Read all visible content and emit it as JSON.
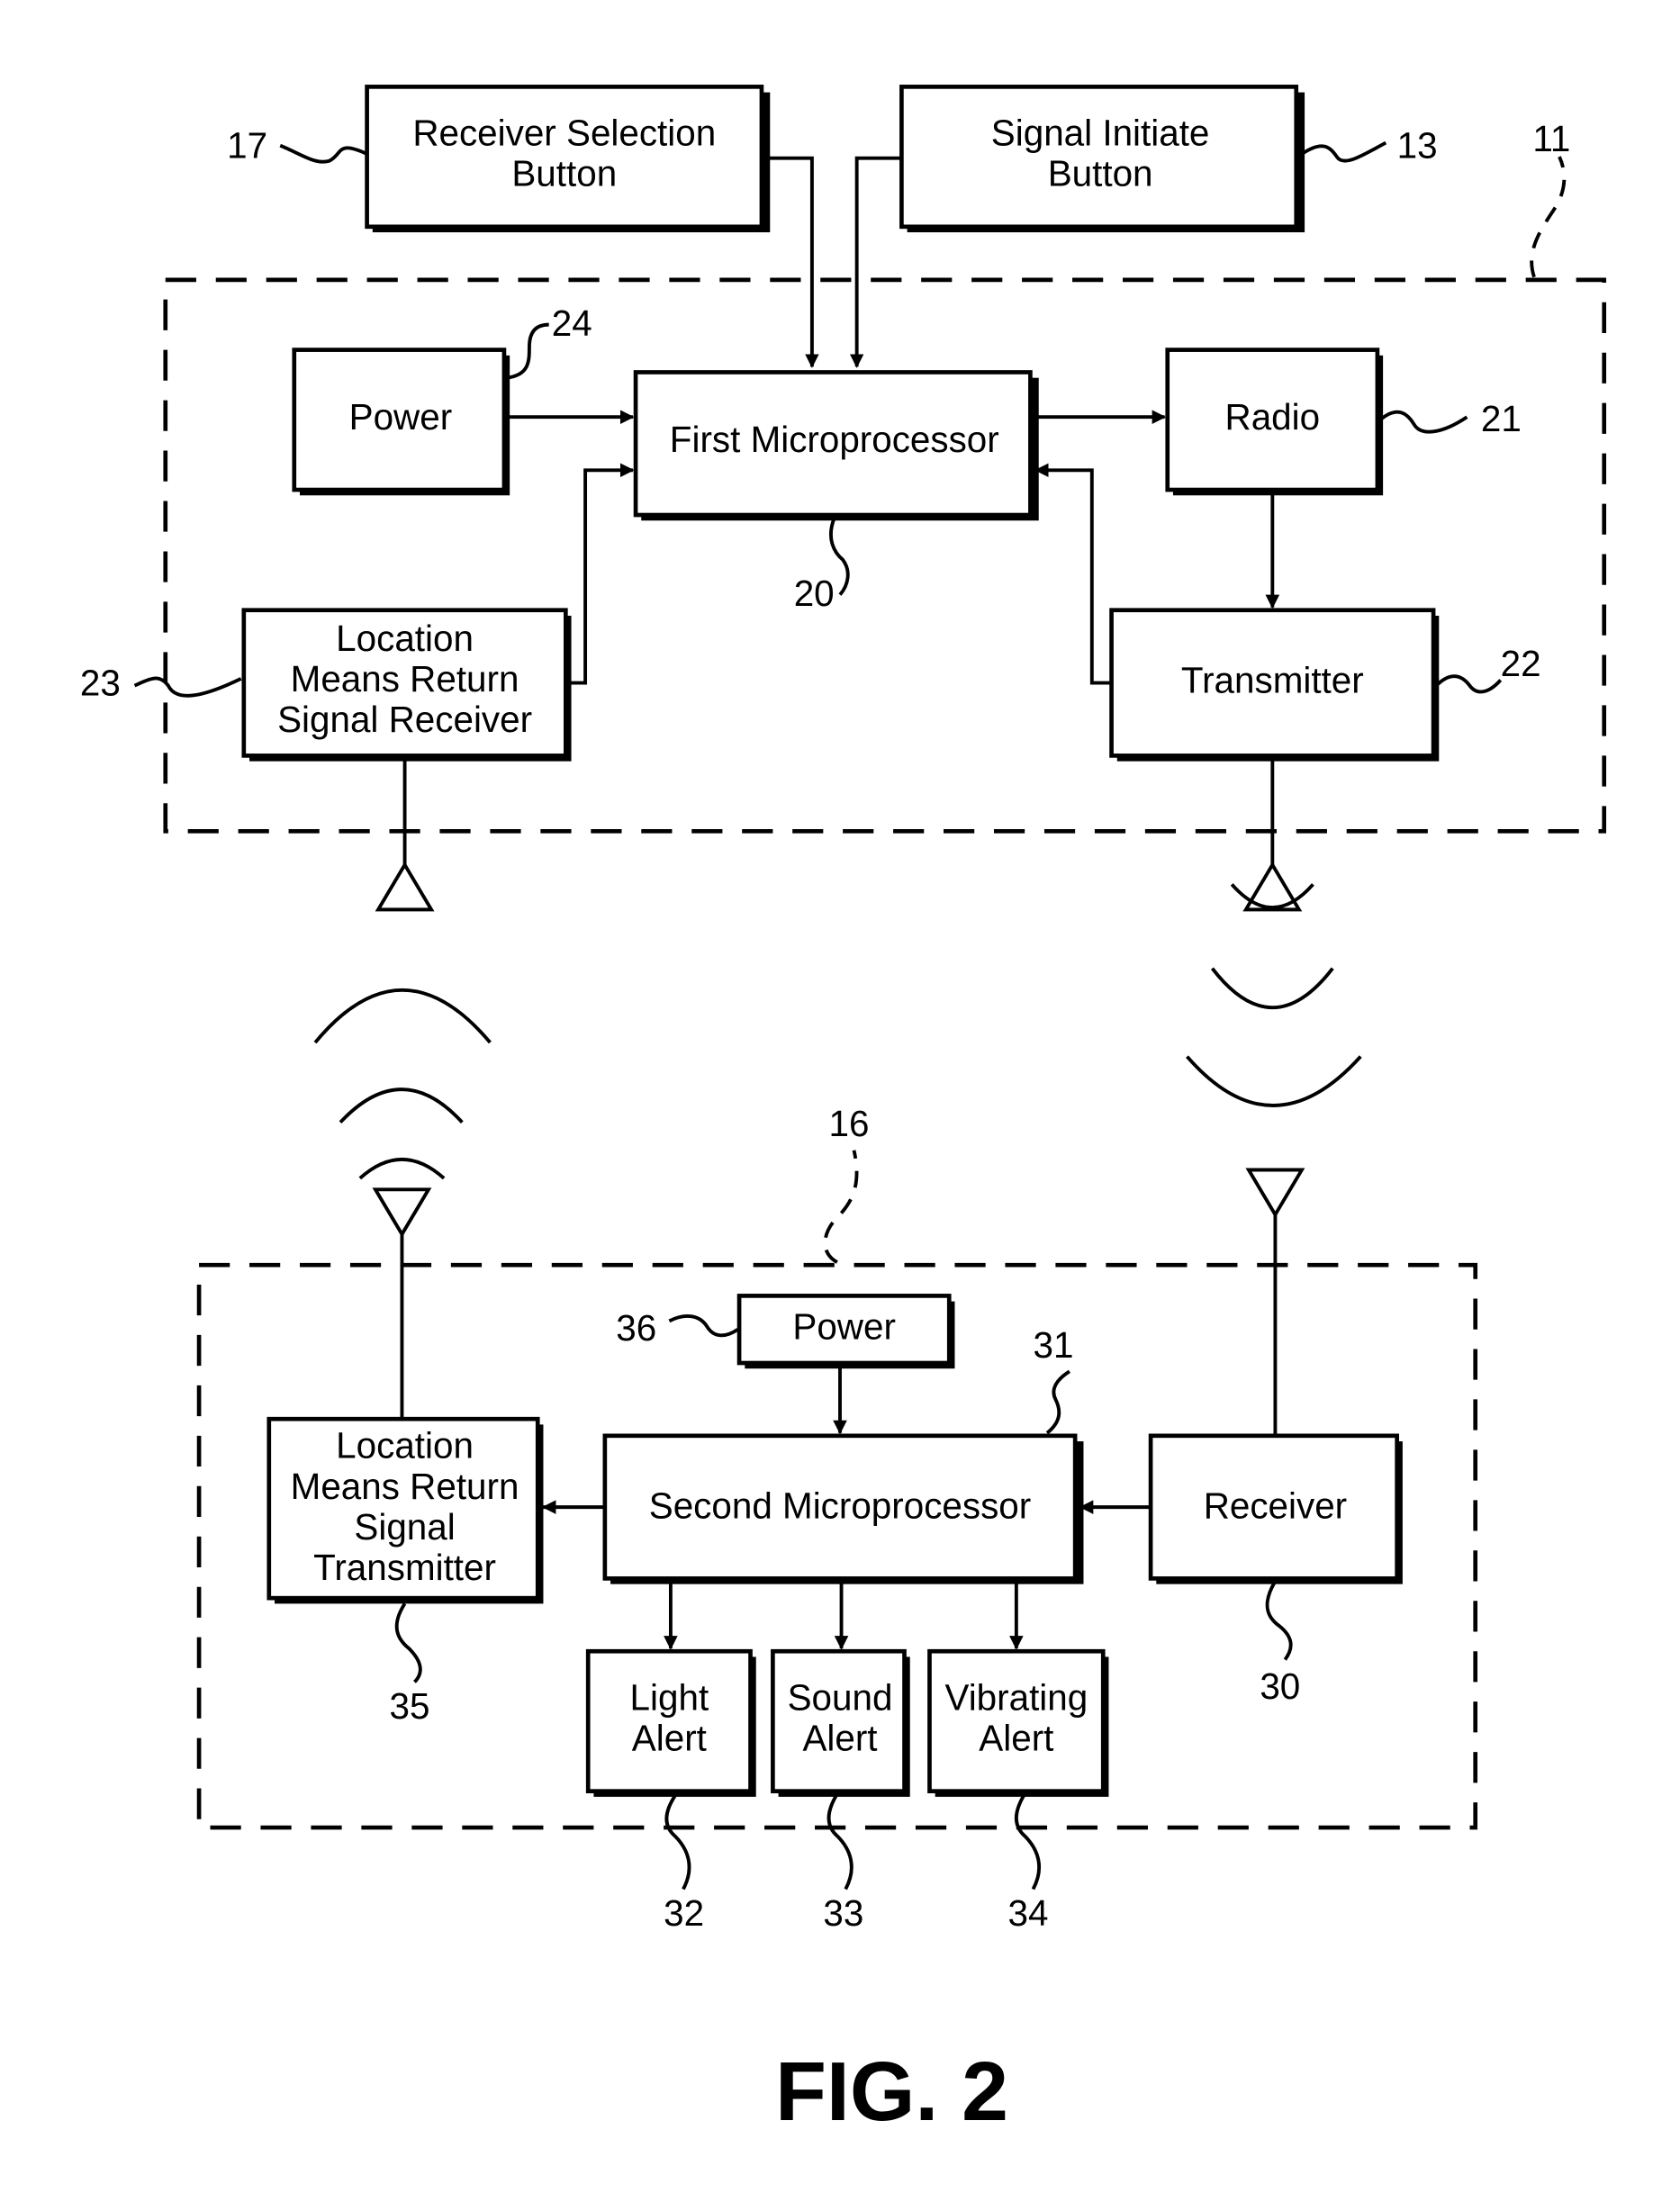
{
  "figure_label": "FIG. 2",
  "transmitter_unit": {
    "ref": "11",
    "blocks": {
      "receiver_selection_button": {
        "lines": [
          "Receiver Selection",
          "Button"
        ],
        "ref": "17"
      },
      "signal_initiate_button": {
        "lines": [
          "Signal Initiate",
          "Button"
        ],
        "ref": "13"
      },
      "power": {
        "lines": [
          "Power"
        ],
        "ref": "24"
      },
      "first_microprocessor": {
        "lines": [
          "First Microprocessor"
        ],
        "ref": "20"
      },
      "radio": {
        "lines": [
          "Radio"
        ],
        "ref": "21"
      },
      "location_return_receiver": {
        "lines": [
          "Location",
          "Means Return",
          "Signal Receiver"
        ],
        "ref": "23"
      },
      "transmitter": {
        "lines": [
          "Transmitter"
        ],
        "ref": "22"
      }
    }
  },
  "receiver_unit": {
    "ref": "16",
    "blocks": {
      "power": {
        "lines": [
          "Power"
        ],
        "ref": "36"
      },
      "second_microprocessor": {
        "lines": [
          "Second Microprocessor"
        ],
        "ref": "31"
      },
      "location_return_transmitter": {
        "lines": [
          "Location",
          "Means Return",
          "Signal",
          "Transmitter"
        ],
        "ref": "35"
      },
      "receiver": {
        "lines": [
          "Receiver"
        ],
        "ref": "30"
      },
      "light_alert": {
        "lines": [
          "Light",
          "Alert"
        ],
        "ref": "32"
      },
      "sound_alert": {
        "lines": [
          "Sound",
          "Alert"
        ],
        "ref": "33"
      },
      "vibrating_alert": {
        "lines": [
          "Vibrating",
          "Alert"
        ],
        "ref": "34"
      }
    }
  }
}
